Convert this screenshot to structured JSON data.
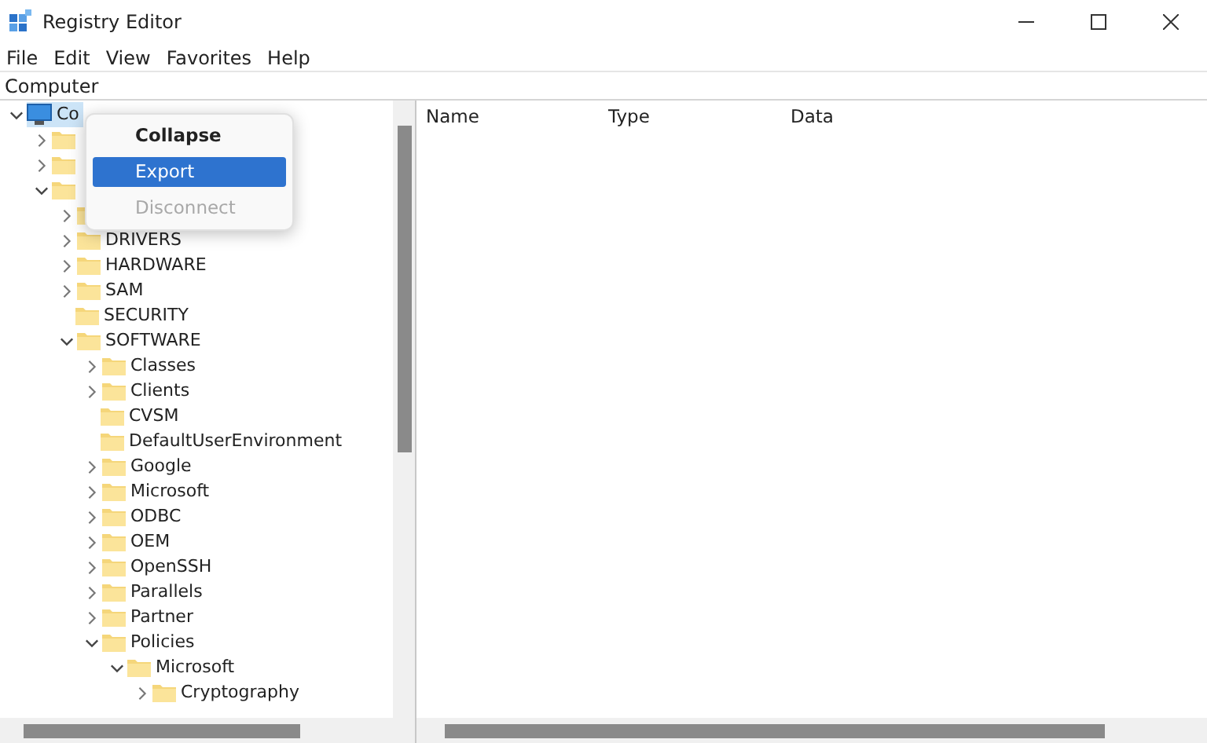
{
  "window": {
    "title": "Registry Editor"
  },
  "menu": [
    "File",
    "Edit",
    "View",
    "Favorites",
    "Help"
  ],
  "address": "Computer",
  "tree": [
    {
      "label": "Co",
      "expanded": true,
      "selected": true,
      "children": [
        {
          "expanded": false,
          "selected": false
        },
        {
          "expanded": false,
          "selected": false
        },
        {
          "expanded": true,
          "selected": false,
          "children": [
            {
              "expanded": false,
              "selected": false
            },
            {
              "label": "DRIVERS",
              "expanded": false,
              "selected": false
            },
            {
              "label": "HARDWARE",
              "expanded": false,
              "selected": false
            },
            {
              "label": "SAM",
              "expanded": false,
              "selected": false
            },
            {
              "label": "SECURITY",
              "selected": false
            },
            {
              "label": "SOFTWARE",
              "expanded": true,
              "selected": false,
              "children": [
                {
                  "label": "Classes",
                  "expanded": false,
                  "selected": false
                },
                {
                  "label": "Clients",
                  "expanded": false,
                  "selected": false
                },
                {
                  "label": "CVSM",
                  "selected": false
                },
                {
                  "label": "DefaultUserEnvironment",
                  "selected": false
                },
                {
                  "label": "Google",
                  "expanded": false,
                  "selected": false
                },
                {
                  "label": "Microsoft",
                  "expanded": false,
                  "selected": false
                },
                {
                  "label": "ODBC",
                  "expanded": false,
                  "selected": false
                },
                {
                  "label": "OEM",
                  "expanded": false,
                  "selected": false
                },
                {
                  "label": "OpenSSH",
                  "expanded": false,
                  "selected": false
                },
                {
                  "label": "Parallels",
                  "expanded": false,
                  "selected": false
                },
                {
                  "label": "Partner",
                  "expanded": false,
                  "selected": false
                },
                {
                  "label": "Policies",
                  "expanded": true,
                  "selected": false,
                  "children": [
                    {
                      "label": "Microsoft",
                      "expanded": true,
                      "selected": false,
                      "children": [
                        {
                          "label": "Cryptography",
                          "expanded": false,
                          "selected": false
                        }
                      ]
                    }
                  ]
                }
              ]
            }
          ]
        }
      ]
    }
  ],
  "context_menu": [
    {
      "label": "Collapse",
      "bold": true,
      "selected": false,
      "disabled": false
    },
    {
      "label": "Export",
      "bold": false,
      "selected": true,
      "disabled": false
    },
    {
      "label": "Disconnect",
      "bold": false,
      "selected": false,
      "disabled": true
    }
  ],
  "columns": [
    "Name",
    "Type",
    "Data"
  ]
}
